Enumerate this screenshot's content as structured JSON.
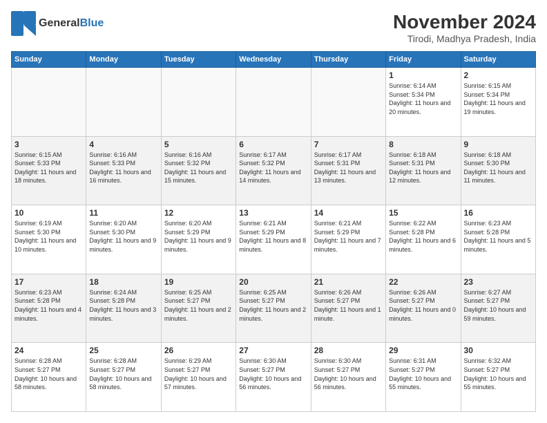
{
  "logo": {
    "general": "General",
    "blue": "Blue"
  },
  "title": "November 2024",
  "location": "Tirodi, Madhya Pradesh, India",
  "weekdays": [
    "Sunday",
    "Monday",
    "Tuesday",
    "Wednesday",
    "Thursday",
    "Friday",
    "Saturday"
  ],
  "weeks": [
    [
      {
        "day": "",
        "info": ""
      },
      {
        "day": "",
        "info": ""
      },
      {
        "day": "",
        "info": ""
      },
      {
        "day": "",
        "info": ""
      },
      {
        "day": "",
        "info": ""
      },
      {
        "day": "1",
        "info": "Sunrise: 6:14 AM\nSunset: 5:34 PM\nDaylight: 11 hours and 20 minutes."
      },
      {
        "day": "2",
        "info": "Sunrise: 6:15 AM\nSunset: 5:34 PM\nDaylight: 11 hours and 19 minutes."
      }
    ],
    [
      {
        "day": "3",
        "info": "Sunrise: 6:15 AM\nSunset: 5:33 PM\nDaylight: 11 hours and 18 minutes."
      },
      {
        "day": "4",
        "info": "Sunrise: 6:16 AM\nSunset: 5:33 PM\nDaylight: 11 hours and 16 minutes."
      },
      {
        "day": "5",
        "info": "Sunrise: 6:16 AM\nSunset: 5:32 PM\nDaylight: 11 hours and 15 minutes."
      },
      {
        "day": "6",
        "info": "Sunrise: 6:17 AM\nSunset: 5:32 PM\nDaylight: 11 hours and 14 minutes."
      },
      {
        "day": "7",
        "info": "Sunrise: 6:17 AM\nSunset: 5:31 PM\nDaylight: 11 hours and 13 minutes."
      },
      {
        "day": "8",
        "info": "Sunrise: 6:18 AM\nSunset: 5:31 PM\nDaylight: 11 hours and 12 minutes."
      },
      {
        "day": "9",
        "info": "Sunrise: 6:18 AM\nSunset: 5:30 PM\nDaylight: 11 hours and 11 minutes."
      }
    ],
    [
      {
        "day": "10",
        "info": "Sunrise: 6:19 AM\nSunset: 5:30 PM\nDaylight: 11 hours and 10 minutes."
      },
      {
        "day": "11",
        "info": "Sunrise: 6:20 AM\nSunset: 5:30 PM\nDaylight: 11 hours and 9 minutes."
      },
      {
        "day": "12",
        "info": "Sunrise: 6:20 AM\nSunset: 5:29 PM\nDaylight: 11 hours and 9 minutes."
      },
      {
        "day": "13",
        "info": "Sunrise: 6:21 AM\nSunset: 5:29 PM\nDaylight: 11 hours and 8 minutes."
      },
      {
        "day": "14",
        "info": "Sunrise: 6:21 AM\nSunset: 5:29 PM\nDaylight: 11 hours and 7 minutes."
      },
      {
        "day": "15",
        "info": "Sunrise: 6:22 AM\nSunset: 5:28 PM\nDaylight: 11 hours and 6 minutes."
      },
      {
        "day": "16",
        "info": "Sunrise: 6:23 AM\nSunset: 5:28 PM\nDaylight: 11 hours and 5 minutes."
      }
    ],
    [
      {
        "day": "17",
        "info": "Sunrise: 6:23 AM\nSunset: 5:28 PM\nDaylight: 11 hours and 4 minutes."
      },
      {
        "day": "18",
        "info": "Sunrise: 6:24 AM\nSunset: 5:28 PM\nDaylight: 11 hours and 3 minutes."
      },
      {
        "day": "19",
        "info": "Sunrise: 6:25 AM\nSunset: 5:27 PM\nDaylight: 11 hours and 2 minutes."
      },
      {
        "day": "20",
        "info": "Sunrise: 6:25 AM\nSunset: 5:27 PM\nDaylight: 11 hours and 2 minutes."
      },
      {
        "day": "21",
        "info": "Sunrise: 6:26 AM\nSunset: 5:27 PM\nDaylight: 11 hours and 1 minute."
      },
      {
        "day": "22",
        "info": "Sunrise: 6:26 AM\nSunset: 5:27 PM\nDaylight: 11 hours and 0 minutes."
      },
      {
        "day": "23",
        "info": "Sunrise: 6:27 AM\nSunset: 5:27 PM\nDaylight: 10 hours and 59 minutes."
      }
    ],
    [
      {
        "day": "24",
        "info": "Sunrise: 6:28 AM\nSunset: 5:27 PM\nDaylight: 10 hours and 58 minutes."
      },
      {
        "day": "25",
        "info": "Sunrise: 6:28 AM\nSunset: 5:27 PM\nDaylight: 10 hours and 58 minutes."
      },
      {
        "day": "26",
        "info": "Sunrise: 6:29 AM\nSunset: 5:27 PM\nDaylight: 10 hours and 57 minutes."
      },
      {
        "day": "27",
        "info": "Sunrise: 6:30 AM\nSunset: 5:27 PM\nDaylight: 10 hours and 56 minutes."
      },
      {
        "day": "28",
        "info": "Sunrise: 6:30 AM\nSunset: 5:27 PM\nDaylight: 10 hours and 56 minutes."
      },
      {
        "day": "29",
        "info": "Sunrise: 6:31 AM\nSunset: 5:27 PM\nDaylight: 10 hours and 55 minutes."
      },
      {
        "day": "30",
        "info": "Sunrise: 6:32 AM\nSunset: 5:27 PM\nDaylight: 10 hours and 55 minutes."
      }
    ]
  ]
}
